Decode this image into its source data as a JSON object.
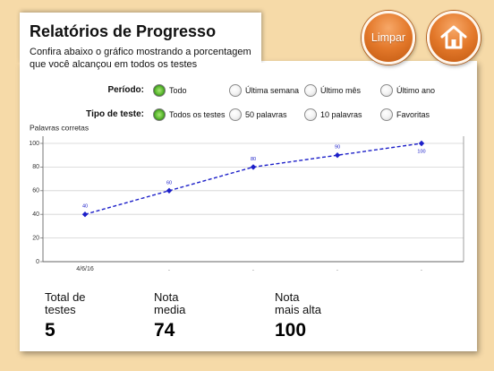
{
  "header": {
    "title": "Relatórios de Progresso",
    "subtitle_lines": [
      "Confira abaixo o gráfico mostrando a porcentagem",
      "que você alcançou em todos os testes"
    ]
  },
  "toolbar": {
    "clear_label": "Limpar",
    "home_icon": "home-icon"
  },
  "colors": {
    "background": "#F6DAA8",
    "button_orange": "#E3782A",
    "radio_selected": "#5CB931",
    "series": "#1D20C9"
  },
  "filters": [
    {
      "label": "Período:",
      "options": [
        {
          "label": "Todo",
          "selected": true
        },
        {
          "label": "Última semana",
          "selected": false
        },
        {
          "label": "Último mês",
          "selected": false
        },
        {
          "label": "Último ano",
          "selected": false
        }
      ]
    },
    {
      "label": "Tipo de teste:",
      "options": [
        {
          "label": "Todos os testes",
          "selected": true
        },
        {
          "label": "50 palavras",
          "selected": false
        },
        {
          "label": "10 palavras",
          "selected": false
        },
        {
          "label": "Favoritas",
          "selected": false
        }
      ]
    }
  ],
  "chart_data": {
    "type": "line",
    "ylabel": "Palavras corretas",
    "categories": [
      "4/6/16",
      ".",
      ".",
      ".",
      "."
    ],
    "series": [
      {
        "values": [
          40,
          60,
          80,
          90,
          100
        ]
      }
    ],
    "ylim": [
      0,
      100
    ],
    "yticks": [
      0,
      20,
      40,
      60,
      80,
      100
    ],
    "grid": true
  },
  "stats": [
    {
      "label_lines": [
        "Total de",
        "testes"
      ],
      "value": "5"
    },
    {
      "label_lines": [
        "Nota",
        "media"
      ],
      "value": "74"
    },
    {
      "label_lines": [
        "Nota",
        "mais alta"
      ],
      "value": "100"
    }
  ]
}
